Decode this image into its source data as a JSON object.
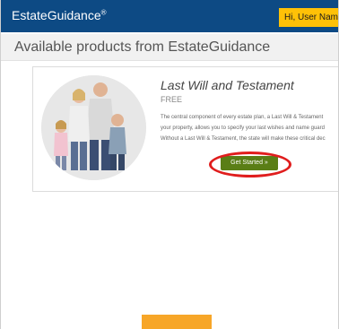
{
  "header": {
    "brand": "EstateGuidance",
    "brand_mark": "®",
    "user_greeting": "Hi, User Name"
  },
  "page": {
    "title": "Available products from EstateGuidance"
  },
  "product": {
    "title": "Last Will and Testament",
    "price": "FREE",
    "description": [
      "The central component of every estate plan, a Last Will & Testament",
      "your property, allows you to specify your last wishes and name guard",
      "Without a Last Will & Testament, the state will make these critical dec"
    ],
    "cta_label": "Get Started »",
    "photo": "family-photo"
  },
  "colors": {
    "topbar": "#0d4a84",
    "user_badge": "#ffc107",
    "cta": "#5a7e16",
    "highlight_ring": "#e01d1d",
    "bottom_button": "#f7a628"
  }
}
